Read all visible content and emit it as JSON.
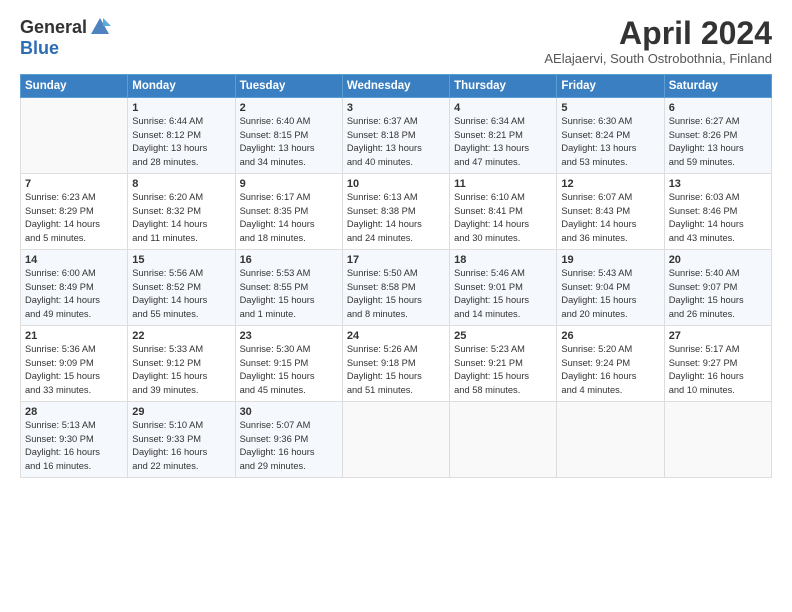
{
  "header": {
    "logo_general": "General",
    "logo_blue": "Blue",
    "month_title": "April 2024",
    "location": "AElajaervi, South Ostrobothnia, Finland"
  },
  "weekdays": [
    "Sunday",
    "Monday",
    "Tuesday",
    "Wednesday",
    "Thursday",
    "Friday",
    "Saturday"
  ],
  "weeks": [
    [
      {
        "day": "",
        "info": ""
      },
      {
        "day": "1",
        "info": "Sunrise: 6:44 AM\nSunset: 8:12 PM\nDaylight: 13 hours\nand 28 minutes."
      },
      {
        "day": "2",
        "info": "Sunrise: 6:40 AM\nSunset: 8:15 PM\nDaylight: 13 hours\nand 34 minutes."
      },
      {
        "day": "3",
        "info": "Sunrise: 6:37 AM\nSunset: 8:18 PM\nDaylight: 13 hours\nand 40 minutes."
      },
      {
        "day": "4",
        "info": "Sunrise: 6:34 AM\nSunset: 8:21 PM\nDaylight: 13 hours\nand 47 minutes."
      },
      {
        "day": "5",
        "info": "Sunrise: 6:30 AM\nSunset: 8:24 PM\nDaylight: 13 hours\nand 53 minutes."
      },
      {
        "day": "6",
        "info": "Sunrise: 6:27 AM\nSunset: 8:26 PM\nDaylight: 13 hours\nand 59 minutes."
      }
    ],
    [
      {
        "day": "7",
        "info": "Sunrise: 6:23 AM\nSunset: 8:29 PM\nDaylight: 14 hours\nand 5 minutes."
      },
      {
        "day": "8",
        "info": "Sunrise: 6:20 AM\nSunset: 8:32 PM\nDaylight: 14 hours\nand 11 minutes."
      },
      {
        "day": "9",
        "info": "Sunrise: 6:17 AM\nSunset: 8:35 PM\nDaylight: 14 hours\nand 18 minutes."
      },
      {
        "day": "10",
        "info": "Sunrise: 6:13 AM\nSunset: 8:38 PM\nDaylight: 14 hours\nand 24 minutes."
      },
      {
        "day": "11",
        "info": "Sunrise: 6:10 AM\nSunset: 8:41 PM\nDaylight: 14 hours\nand 30 minutes."
      },
      {
        "day": "12",
        "info": "Sunrise: 6:07 AM\nSunset: 8:43 PM\nDaylight: 14 hours\nand 36 minutes."
      },
      {
        "day": "13",
        "info": "Sunrise: 6:03 AM\nSunset: 8:46 PM\nDaylight: 14 hours\nand 43 minutes."
      }
    ],
    [
      {
        "day": "14",
        "info": "Sunrise: 6:00 AM\nSunset: 8:49 PM\nDaylight: 14 hours\nand 49 minutes."
      },
      {
        "day": "15",
        "info": "Sunrise: 5:56 AM\nSunset: 8:52 PM\nDaylight: 14 hours\nand 55 minutes."
      },
      {
        "day": "16",
        "info": "Sunrise: 5:53 AM\nSunset: 8:55 PM\nDaylight: 15 hours\nand 1 minute."
      },
      {
        "day": "17",
        "info": "Sunrise: 5:50 AM\nSunset: 8:58 PM\nDaylight: 15 hours\nand 8 minutes."
      },
      {
        "day": "18",
        "info": "Sunrise: 5:46 AM\nSunset: 9:01 PM\nDaylight: 15 hours\nand 14 minutes."
      },
      {
        "day": "19",
        "info": "Sunrise: 5:43 AM\nSunset: 9:04 PM\nDaylight: 15 hours\nand 20 minutes."
      },
      {
        "day": "20",
        "info": "Sunrise: 5:40 AM\nSunset: 9:07 PM\nDaylight: 15 hours\nand 26 minutes."
      }
    ],
    [
      {
        "day": "21",
        "info": "Sunrise: 5:36 AM\nSunset: 9:09 PM\nDaylight: 15 hours\nand 33 minutes."
      },
      {
        "day": "22",
        "info": "Sunrise: 5:33 AM\nSunset: 9:12 PM\nDaylight: 15 hours\nand 39 minutes."
      },
      {
        "day": "23",
        "info": "Sunrise: 5:30 AM\nSunset: 9:15 PM\nDaylight: 15 hours\nand 45 minutes."
      },
      {
        "day": "24",
        "info": "Sunrise: 5:26 AM\nSunset: 9:18 PM\nDaylight: 15 hours\nand 51 minutes."
      },
      {
        "day": "25",
        "info": "Sunrise: 5:23 AM\nSunset: 9:21 PM\nDaylight: 15 hours\nand 58 minutes."
      },
      {
        "day": "26",
        "info": "Sunrise: 5:20 AM\nSunset: 9:24 PM\nDaylight: 16 hours\nand 4 minutes."
      },
      {
        "day": "27",
        "info": "Sunrise: 5:17 AM\nSunset: 9:27 PM\nDaylight: 16 hours\nand 10 minutes."
      }
    ],
    [
      {
        "day": "28",
        "info": "Sunrise: 5:13 AM\nSunset: 9:30 PM\nDaylight: 16 hours\nand 16 minutes."
      },
      {
        "day": "29",
        "info": "Sunrise: 5:10 AM\nSunset: 9:33 PM\nDaylight: 16 hours\nand 22 minutes."
      },
      {
        "day": "30",
        "info": "Sunrise: 5:07 AM\nSunset: 9:36 PM\nDaylight: 16 hours\nand 29 minutes."
      },
      {
        "day": "",
        "info": ""
      },
      {
        "day": "",
        "info": ""
      },
      {
        "day": "",
        "info": ""
      },
      {
        "day": "",
        "info": ""
      }
    ]
  ]
}
